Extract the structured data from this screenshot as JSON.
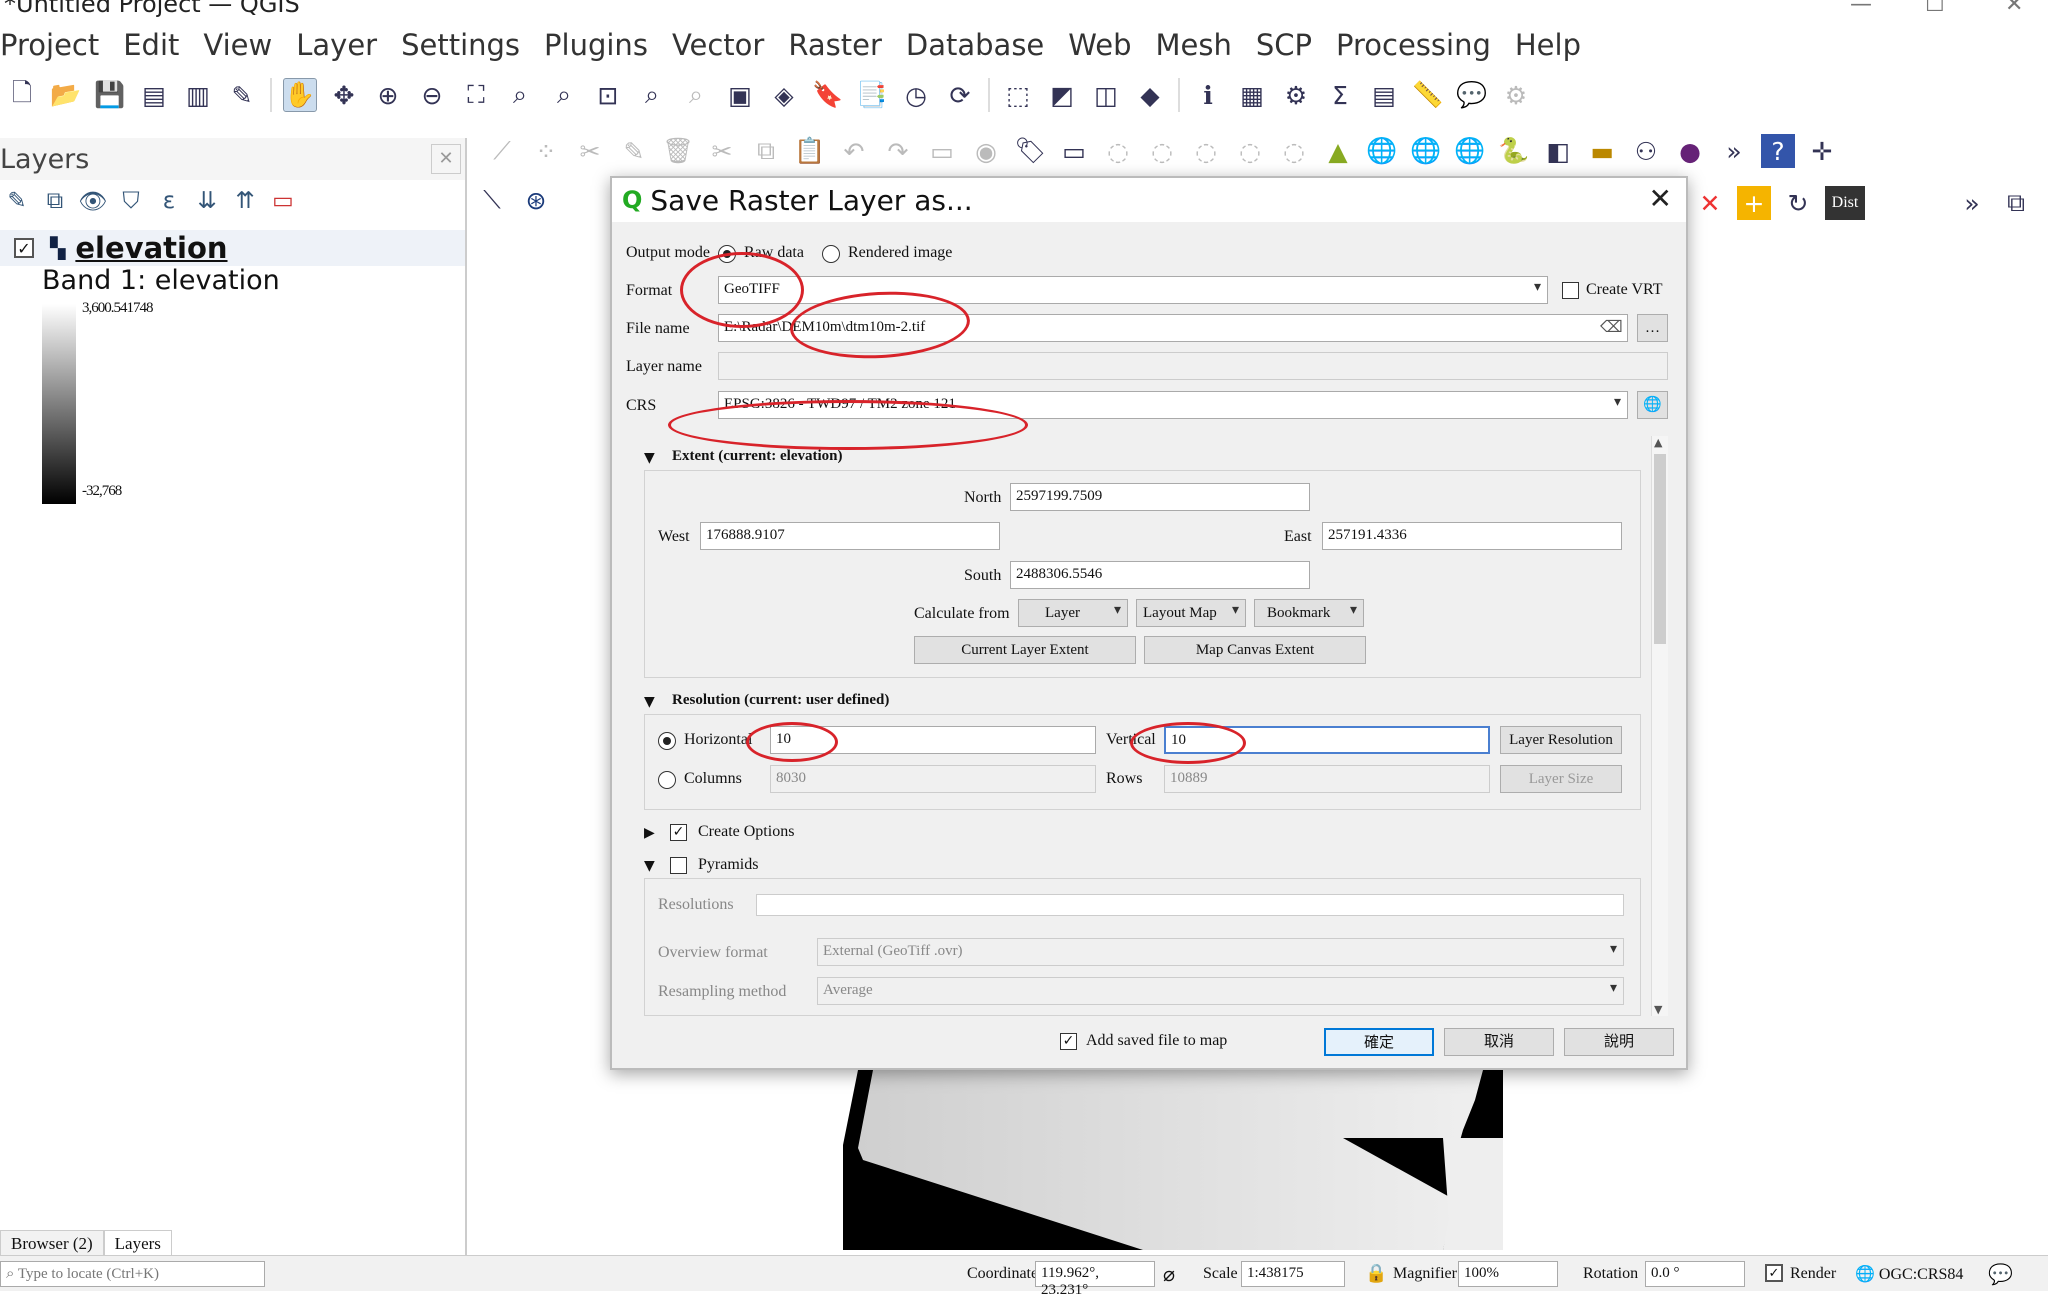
{
  "window": {
    "title": "*Untitled Project — QGIS"
  },
  "menu": [
    "Project",
    "Edit",
    "View",
    "Layer",
    "Settings",
    "Plugins",
    "Vector",
    "Raster",
    "Database",
    "Web",
    "Mesh",
    "SCP",
    "Processing",
    "Help"
  ],
  "layers_panel": {
    "title": "Layers",
    "layer_name": "elevation",
    "band_label": "Band 1: elevation",
    "max_value": "3,600.541748",
    "min_value": "-32,768",
    "tabs": [
      "Browser (2)",
      "Layers"
    ]
  },
  "status": {
    "locate_placeholder": "Type to locate (Ctrl+K)",
    "coordinate_label": "Coordinate",
    "coordinate": "119.962°, 23.231°",
    "scale_label": "Scale",
    "scale": "1:438175",
    "magnifier_label": "Magnifier",
    "magnifier": "100%",
    "rotation_label": "Rotation",
    "rotation": "0.0 °",
    "render_label": "Render",
    "crs": "OGC:CRS84"
  },
  "toolbar": {
    "dist_label": "Dist"
  },
  "dialog": {
    "title": "Save Raster Layer as...",
    "output_mode_label": "Output mode",
    "raw_data": "Raw data",
    "rendered_image": "Rendered image",
    "format_label": "Format",
    "format": "GeoTIFF",
    "create_vrt": "Create VRT",
    "file_name_label": "File name",
    "file_name": "E:\\Radar\\DEM10m\\dtm10m-2.tif",
    "layer_name_label": "Layer name",
    "crs_label": "CRS",
    "crs": "EPSG:3826 - TWD97 / TM2 zone 121",
    "extent": {
      "title": "Extent (current: elevation)",
      "north_label": "North",
      "north": "2597199.7509",
      "west_label": "West",
      "west": "176888.9107",
      "east_label": "East",
      "east": "257191.4336",
      "south_label": "South",
      "south": "2488306.5546",
      "calc_label": "Calculate from",
      "layer": "Layer",
      "layout_map": "Layout Map",
      "bookmark": "Bookmark",
      "current_layer_extent": "Current Layer Extent",
      "map_canvas_extent": "Map Canvas Extent"
    },
    "resolution": {
      "title": "Resolution (current: user defined)",
      "horizontal_label": "Horizontal",
      "horizontal": "10",
      "vertical_label": "Vertical",
      "vertical": "10",
      "layer_resolution": "Layer Resolution",
      "columns_label": "Columns",
      "columns": "8030",
      "rows_label": "Rows",
      "rows": "10889",
      "layer_size": "Layer Size"
    },
    "create_options": "Create Options",
    "pyramids": {
      "title": "Pyramids",
      "resolutions_label": "Resolutions",
      "overview_format_label": "Overview format",
      "overview_format": "External (GeoTiff .ovr)",
      "resampling_label": "Resampling method",
      "resampling": "Average"
    },
    "add_saved": "Add saved file to map",
    "ok": "確定",
    "cancel": "取消",
    "help": "說明"
  },
  "colors": {
    "annotation": "#d8232a",
    "focus": "#4a7fd0"
  }
}
